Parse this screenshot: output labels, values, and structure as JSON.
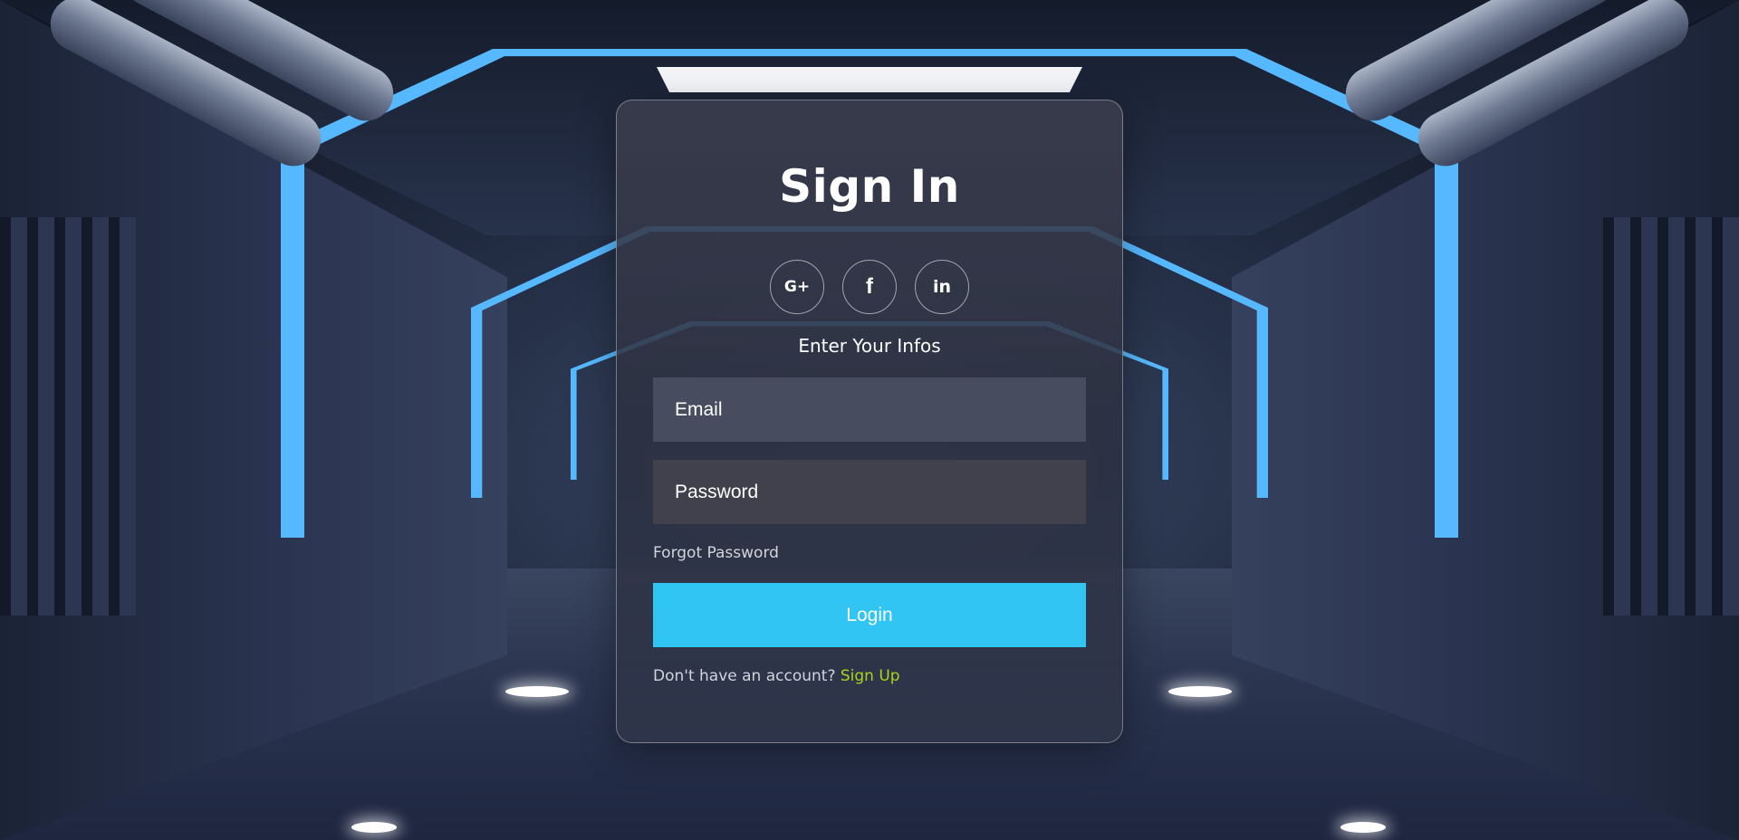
{
  "form": {
    "title": "Sign In",
    "subtitle": "Enter Your Infos",
    "email_placeholder": "Email",
    "password_placeholder": "Password",
    "forgot_label": "Forgot Password",
    "login_label": "Login",
    "signup_prompt": "Don't have an account?",
    "signup_link": "Sign Up"
  },
  "social": {
    "google": "G+",
    "facebook": "f",
    "linkedin": "in"
  },
  "colors": {
    "accent": "#30c5f3",
    "link": "#a8d51c",
    "neon": "#56b9ff"
  },
  "icons": {
    "google": "google-plus-icon",
    "facebook": "facebook-icon",
    "linkedin": "linkedin-icon"
  }
}
